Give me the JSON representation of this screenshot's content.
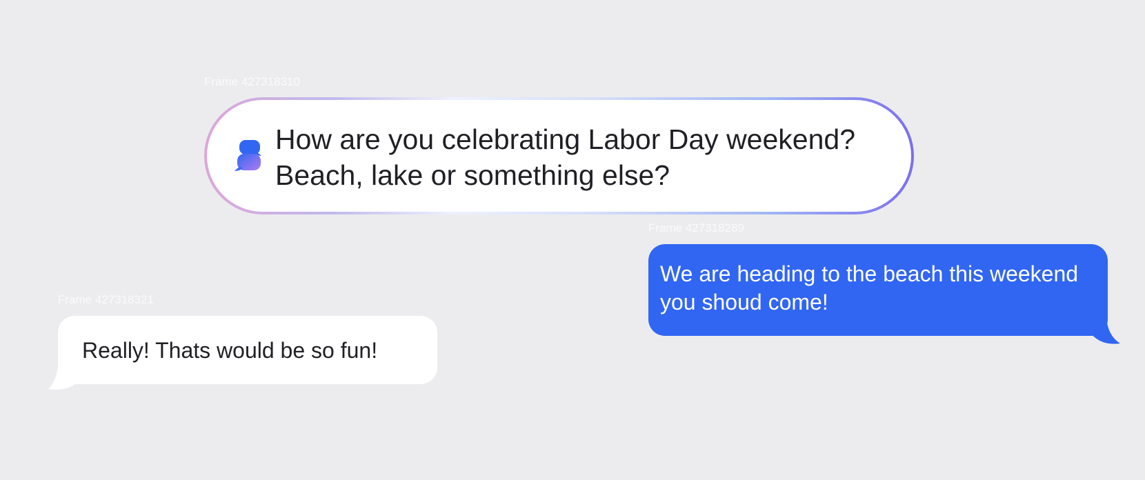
{
  "frames": {
    "prompt_label": "Frame 427318310",
    "sent_label": "Frame 427318289",
    "received_label": "Frame 427318321"
  },
  "prompt": {
    "icon": "chat-bubbles-icon",
    "line1": "How are you celebrating Labor Day weekend?",
    "line2": "Beach, lake or something else?"
  },
  "sent_message": {
    "line1": "We are heading to the beach this weekend",
    "line2": "you shoud come!"
  },
  "received_message": {
    "text": "Really! Thats would be so fun!"
  },
  "colors": {
    "background": "#ECECEE",
    "sent_bubble": "#3166F3",
    "received_bubble": "#FFFFFF",
    "text_dark": "#1F1F24",
    "text_light": "#FFFFFF"
  }
}
